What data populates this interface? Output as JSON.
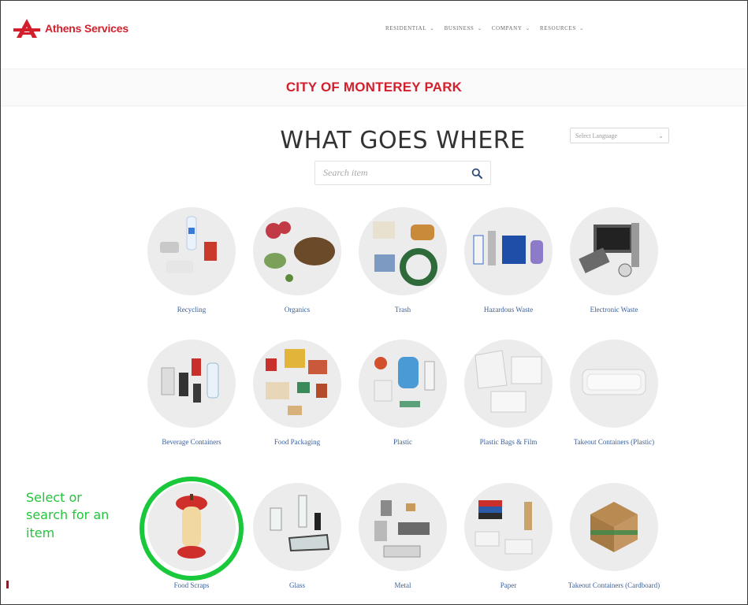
{
  "header": {
    "brand": "Athens Services",
    "nav": [
      {
        "label": "RESIDENTIAL"
      },
      {
        "label": "BUSINESS"
      },
      {
        "label": "COMPANY"
      },
      {
        "label": "RESOURCES"
      }
    ]
  },
  "banner": {
    "title": "CITY OF MONTEREY PARK"
  },
  "main": {
    "title": "WHAT GOES WHERE",
    "search_placeholder": "Search item",
    "language_select": "Select Language"
  },
  "categories": [
    {
      "label": "Recycling"
    },
    {
      "label": "Organics"
    },
    {
      "label": "Trash"
    },
    {
      "label": "Hazardous Waste"
    },
    {
      "label": "Electronic Waste"
    },
    {
      "label": "Beverage Containers"
    },
    {
      "label": "Food Packaging"
    },
    {
      "label": "Plastic"
    },
    {
      "label": "Plastic Bags & Film"
    },
    {
      "label": "Takeout Containers (Plastic)"
    },
    {
      "label": "Food Scraps"
    },
    {
      "label": "Glass"
    },
    {
      "label": "Metal"
    },
    {
      "label": "Paper"
    },
    {
      "label": "Takeout Containers (Cardboard)"
    }
  ],
  "callout": {
    "line1": "Select or",
    "line2": "search for an",
    "line3": "item"
  },
  "colors": {
    "brand_red": "#d21f2b",
    "link_blue": "#3b5f9a",
    "highlight_green": "#19c93b"
  }
}
